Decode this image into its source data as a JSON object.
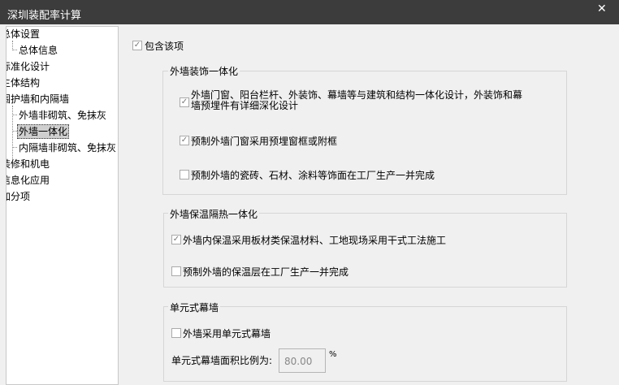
{
  "window": {
    "title": "深圳装配率计算",
    "close": "✕"
  },
  "tree": {
    "items": [
      {
        "label": "总体设置"
      },
      {
        "label": "总体信息"
      },
      {
        "label": "标准化设计"
      },
      {
        "label": "主体结构"
      },
      {
        "label": "围护墙和内隔墙"
      },
      {
        "label": "外墙非砌筑、免抹灰"
      },
      {
        "label": "外墙一体化"
      },
      {
        "label": "内隔墙非砌筑、免抹灰"
      },
      {
        "label": "装修和机电"
      },
      {
        "label": "信息化应用"
      },
      {
        "label": "加分项"
      }
    ],
    "selected": "外墙一体化"
  },
  "include": {
    "label": "包含该项",
    "checked": true
  },
  "groups": [
    {
      "title": "外墙装饰一体化",
      "items": [
        {
          "label": "外墙门窗、阳台栏杆、外装饰、幕墙等与建筑和结构一体化设计，外装饰和幕墙预埋件有详细深化设计",
          "checked": true
        },
        {
          "label": "预制外墙门窗采用预埋窗框或附框",
          "checked": true
        },
        {
          "label": "预制外墙的瓷砖、石材、涂料等饰面在工厂生产一并完成",
          "checked": false
        }
      ]
    },
    {
      "title": "外墙保温隔热一体化",
      "items": [
        {
          "label": "外墙内保温采用板材类保温材料、工地现场采用干式工法施工",
          "checked": true
        },
        {
          "label": "预制外墙的保温层在工厂生产一并完成",
          "checked": false
        }
      ]
    },
    {
      "title": "单元式幕墙",
      "items": [
        {
          "label": "外墙采用单元式幕墙",
          "checked": false
        }
      ],
      "ratio_label": "单元式幕墙面积比例为:",
      "ratio_value": "80.00",
      "unit": "%"
    }
  ]
}
